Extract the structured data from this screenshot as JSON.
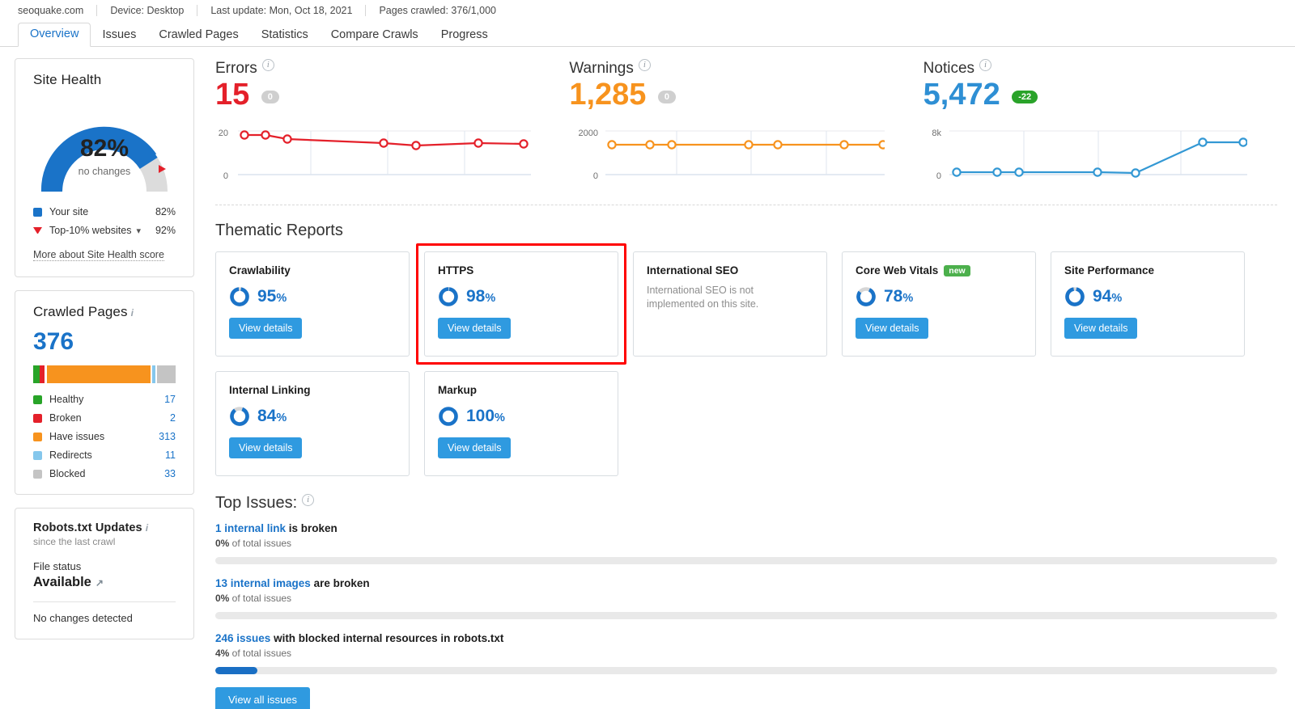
{
  "meta": {
    "domain": "seoquake.com",
    "device": "Device: Desktop",
    "last_update": "Last update: Mon, Oct 18, 2021",
    "pages_crawled": "Pages crawled: 376/1,000"
  },
  "tabs": [
    {
      "label": "Overview",
      "active": true
    },
    {
      "label": "Issues",
      "active": false
    },
    {
      "label": "Crawled Pages",
      "active": false
    },
    {
      "label": "Statistics",
      "active": false
    },
    {
      "label": "Compare Crawls",
      "active": false
    },
    {
      "label": "Progress",
      "active": false
    }
  ],
  "site_health": {
    "title": "Site Health",
    "score": "82%",
    "change": "no changes",
    "legend": [
      {
        "label": "Your site",
        "value": "82%",
        "color": "#1a73c8",
        "marker": "square"
      },
      {
        "label": "Top-10% websites",
        "value": "92%",
        "color": "#e4202a",
        "marker": "triangle"
      }
    ],
    "more_link": "More about Site Health score"
  },
  "crawled_pages": {
    "title": "Crawled Pages",
    "total": "376",
    "legend": [
      {
        "label": "Healthy",
        "value": "17",
        "color": "#28a428"
      },
      {
        "label": "Broken",
        "value": "2",
        "color": "#e4202a"
      },
      {
        "label": "Have issues",
        "value": "313",
        "color": "#f7931e"
      },
      {
        "label": "Redirects",
        "value": "11",
        "color": "#85c7ec"
      },
      {
        "label": "Blocked",
        "value": "33",
        "color": "#c4c4c4"
      }
    ]
  },
  "robots": {
    "title": "Robots.txt Updates",
    "subtitle": "since the last crawl",
    "field_label": "File status",
    "field_value": "Available",
    "note": "No changes detected"
  },
  "metrics": [
    {
      "title": "Errors",
      "value": "15",
      "delta": "0",
      "delta_kind": "zero",
      "color": "#e4202a",
      "axis_top": "20",
      "axis_bottom": "0"
    },
    {
      "title": "Warnings",
      "value": "1,285",
      "delta": "0",
      "delta_kind": "zero",
      "color": "#f7931e",
      "axis_top": "2000",
      "axis_bottom": "0"
    },
    {
      "title": "Notices",
      "value": "5,472",
      "delta": "-22",
      "delta_kind": "good",
      "color": "#3398d4",
      "axis_top": "8k",
      "axis_bottom": "0"
    }
  ],
  "thematic": {
    "title": "Thematic Reports",
    "cards": [
      {
        "name": "Crawlability",
        "pct": "95",
        "suffix": "%",
        "button": "View details",
        "highlight": false,
        "badge": null,
        "desc": null
      },
      {
        "name": "HTTPS",
        "pct": "98",
        "suffix": "%",
        "button": "View details",
        "highlight": true,
        "badge": null,
        "desc": null
      },
      {
        "name": "International SEO",
        "pct": null,
        "suffix": null,
        "button": null,
        "highlight": false,
        "badge": null,
        "desc": "International SEO is not implemented on this site."
      },
      {
        "name": "Core Web Vitals",
        "pct": "78",
        "suffix": "%",
        "button": "View details",
        "highlight": false,
        "badge": "new",
        "desc": null
      },
      {
        "name": "Site Performance",
        "pct": "94",
        "suffix": "%",
        "button": "View details",
        "highlight": false,
        "badge": null,
        "desc": null
      },
      {
        "name": "Internal Linking",
        "pct": "84",
        "suffix": "%",
        "button": "View details",
        "highlight": false,
        "badge": null,
        "desc": null
      },
      {
        "name": "Markup",
        "pct": "100",
        "suffix": "%",
        "button": "View details",
        "highlight": false,
        "badge": null,
        "desc": null
      }
    ]
  },
  "top_issues": {
    "title": "Top Issues:",
    "items": [
      {
        "link": "1 internal link",
        "rest": " is broken",
        "pct_text": "0%",
        "sub": " of total issues",
        "bar_pct": 0
      },
      {
        "link": "13 internal images",
        "rest": " are broken",
        "pct_text": "0%",
        "sub": " of total issues",
        "bar_pct": 0
      },
      {
        "link": "246 issues",
        "rest": " with blocked internal resources in robots.txt",
        "pct_text": "4%",
        "sub": " of total issues",
        "bar_pct": 4
      }
    ],
    "button": "View all issues"
  },
  "chart_data": [
    {
      "type": "line",
      "title": "Errors",
      "ylabel": "",
      "xlabel": "",
      "ylim": [
        0,
        20
      ],
      "yticks": [
        0,
        20
      ],
      "ytick_labels": [
        "0",
        "20"
      ],
      "grid": true,
      "x": [
        1,
        2,
        3,
        4,
        5,
        6,
        7
      ],
      "series": [
        {
          "name": "Errors",
          "color": "#e4202a",
          "values": [
            19,
            19,
            18,
            16.5,
            16,
            17,
            17
          ]
        }
      ],
      "current_value": 15,
      "delta": 0
    },
    {
      "type": "line",
      "title": "Warnings",
      "ylabel": "",
      "xlabel": "",
      "ylim": [
        0,
        2000
      ],
      "yticks": [
        0,
        2000
      ],
      "ytick_labels": [
        "0",
        "2000"
      ],
      "grid": true,
      "x": [
        1,
        2,
        3,
        4,
        5,
        6,
        7
      ],
      "series": [
        {
          "name": "Warnings",
          "color": "#f7931e",
          "values": [
            1285,
            1285,
            1285,
            1285,
            1285,
            1285,
            1285
          ]
        }
      ],
      "current_value": 1285,
      "delta": 0
    },
    {
      "type": "line",
      "title": "Notices",
      "ylabel": "",
      "xlabel": "",
      "ylim": [
        0,
        8000
      ],
      "yticks": [
        0,
        8000
      ],
      "ytick_labels": [
        "0",
        "8k"
      ],
      "grid": true,
      "x": [
        1,
        2,
        3,
        4,
        5,
        6,
        7
      ],
      "series": [
        {
          "name": "Notices",
          "color": "#3398d4",
          "values": [
            450,
            450,
            450,
            450,
            420,
            5472,
            5472
          ]
        }
      ],
      "current_value": 5472,
      "delta": -22
    },
    {
      "type": "pie",
      "title": "Site Health",
      "labels": [
        "Your site",
        "Top-10% websites"
      ],
      "values": [
        82,
        92
      ],
      "unit": "%"
    },
    {
      "type": "bar",
      "title": "Crawled Pages",
      "categories": [
        "Healthy",
        "Broken",
        "Have issues",
        "Redirects",
        "Blocked"
      ],
      "values": [
        17,
        2,
        313,
        11,
        33
      ],
      "colors": [
        "#28a428",
        "#e4202a",
        "#f7931e",
        "#85c7ec",
        "#c4c4c4"
      ],
      "total": 376
    },
    {
      "type": "bar",
      "title": "Thematic Reports scores",
      "categories": [
        "Crawlability",
        "HTTPS",
        "Core Web Vitals",
        "Site Performance",
        "Internal Linking",
        "Markup"
      ],
      "values": [
        95,
        98,
        78,
        94,
        84,
        100
      ],
      "ylim": [
        0,
        100
      ],
      "ylabel": "%"
    },
    {
      "type": "bar",
      "title": "Top Issues share of total issues",
      "categories": [
        "1 internal link is broken",
        "13 internal images are broken",
        "246 issues with blocked internal resources in robots.txt"
      ],
      "values": [
        0,
        0,
        4
      ],
      "ylim": [
        0,
        100
      ],
      "ylabel": "% of total issues"
    }
  ]
}
